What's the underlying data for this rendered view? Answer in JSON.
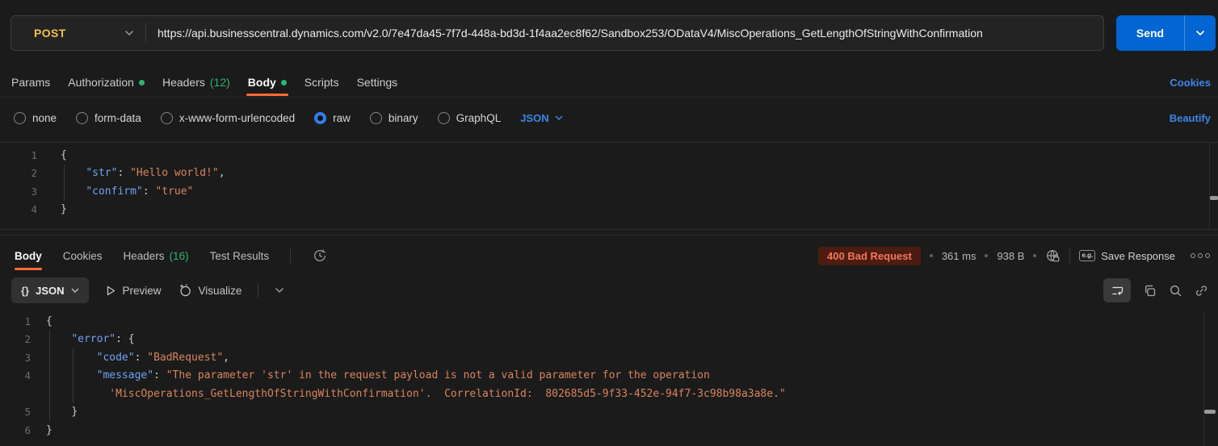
{
  "request": {
    "method": "POST",
    "url": "https://api.businesscentral.dynamics.com/v2.0/7e47da45-7f7d-448a-bd3d-1f4aa2ec8f62/Sandbox253/ODataV4/MiscOperations_GetLengthOfStringWithConfirmation",
    "send_label": "Send",
    "tabs": [
      {
        "label": "Params"
      },
      {
        "label": "Authorization"
      },
      {
        "label": "Headers",
        "count": "(12)"
      },
      {
        "label": "Body"
      },
      {
        "label": "Scripts"
      },
      {
        "label": "Settings"
      }
    ],
    "cookies_link": "Cookies",
    "body_modes": [
      "none",
      "form-data",
      "x-www-form-urlencoded",
      "raw",
      "binary",
      "GraphQL"
    ],
    "selected_mode": "raw",
    "raw_language": "JSON",
    "beautify_label": "Beautify",
    "code": [
      {
        "n": "1",
        "t": [
          [
            "p",
            "{"
          ]
        ]
      },
      {
        "n": "2",
        "t": [
          [
            "p",
            "    "
          ],
          [
            "k",
            "\"str\""
          ],
          [
            "p",
            ": "
          ],
          [
            "s",
            "\"Hello world!\""
          ],
          [
            "p",
            ","
          ]
        ]
      },
      {
        "n": "3",
        "t": [
          [
            "p",
            "    "
          ],
          [
            "k",
            "\"confirm\""
          ],
          [
            "p",
            ": "
          ],
          [
            "s",
            "\"true\""
          ]
        ]
      },
      {
        "n": "4",
        "t": [
          [
            "p",
            "}"
          ]
        ]
      }
    ]
  },
  "response": {
    "tabs": [
      {
        "label": "Body"
      },
      {
        "label": "Cookies"
      },
      {
        "label": "Headers",
        "count": "(16)"
      },
      {
        "label": "Test Results"
      }
    ],
    "status": "400 Bad Request",
    "time": "361 ms",
    "size": "938 B",
    "eg_icon_label": "e.g.",
    "save_label": "Save Response",
    "format_label": "JSON",
    "preview_label": "Preview",
    "visualize_label": "Visualize",
    "code": [
      {
        "n": "1",
        "t": [
          [
            "p",
            "{"
          ]
        ]
      },
      {
        "n": "2",
        "t": [
          [
            "p",
            "    "
          ],
          [
            "k",
            "\"error\""
          ],
          [
            "p",
            ": {"
          ]
        ]
      },
      {
        "n": "3",
        "t": [
          [
            "p",
            "        "
          ],
          [
            "k",
            "\"code\""
          ],
          [
            "p",
            ": "
          ],
          [
            "s",
            "\"BadRequest\""
          ],
          [
            "p",
            ","
          ]
        ]
      },
      {
        "n": "4",
        "t": [
          [
            "p",
            "        "
          ],
          [
            "k",
            "\"message\""
          ],
          [
            "p",
            ": "
          ],
          [
            "s",
            "\"The parameter 'str' in the request payload is not a valid parameter for the operation"
          ]
        ]
      },
      {
        "n": "",
        "t": [
          [
            "p",
            "          "
          ],
          [
            "s",
            "'MiscOperations_GetLengthOfStringWithConfirmation'.  CorrelationId:  802685d5-9f33-452e-94f7-3c98b98a3a8e.\""
          ]
        ]
      },
      {
        "n": "5",
        "t": [
          [
            "p",
            "    "
          ],
          [
            "p",
            "}"
          ]
        ]
      },
      {
        "n": "6",
        "t": [
          [
            "p",
            "}"
          ]
        ]
      }
    ]
  },
  "colors": {
    "method_post": "#f5c04a",
    "send_button": "#0265d2",
    "link_blue": "#3b86e8",
    "success_green": "#2bb673",
    "accent_orange": "#ff6c37",
    "status_error_bg": "#4c1c11",
    "status_error_text": "#f4765f",
    "code_key": "#6ea3f5",
    "code_string": "#d9845f"
  }
}
